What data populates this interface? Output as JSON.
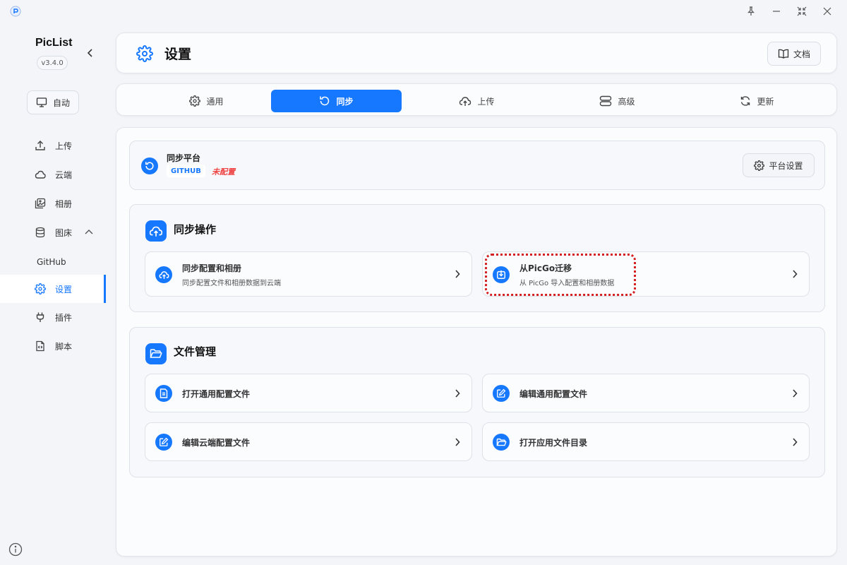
{
  "sidebar": {
    "brand": "PicList",
    "version": "v3.4.0",
    "theme_label": "自动",
    "nav": [
      {
        "label": "上传",
        "icon": "upload-icon"
      },
      {
        "label": "云端",
        "icon": "cloud-icon"
      },
      {
        "label": "相册",
        "icon": "gallery-icon"
      },
      {
        "label": "图床",
        "icon": "database-icon"
      },
      {
        "label": "设置",
        "icon": "gear-icon"
      },
      {
        "label": "插件",
        "icon": "plug-icon"
      },
      {
        "label": "脚本",
        "icon": "script-icon"
      }
    ],
    "sub_item": "GitHub",
    "active": "设置"
  },
  "header": {
    "title": "设置",
    "doc_label": "文档"
  },
  "tabs": [
    {
      "label": "通用",
      "icon": "gear-icon"
    },
    {
      "label": "同步",
      "icon": "sync-icon"
    },
    {
      "label": "上传",
      "icon": "cloud-upload-icon"
    },
    {
      "label": "高级",
      "icon": "advanced-icon"
    },
    {
      "label": "更新",
      "icon": "refresh-icon"
    }
  ],
  "active_tab": "同步",
  "platform": {
    "title": "同步平台",
    "badge": "GITHUB",
    "status": "未配置",
    "settings_label": "平台设置"
  },
  "sync_section": {
    "title": "同步操作",
    "actions": [
      {
        "title": "同步配置和相册",
        "desc": "同步配置文件和相册数据到云端",
        "icon": "cloud-upload-icon"
      },
      {
        "title": "从PicGo迁移",
        "desc": "从 PicGo 导入配置和相册数据",
        "icon": "import-icon"
      }
    ]
  },
  "file_section": {
    "title": "文件管理",
    "actions": [
      {
        "title": "打开通用配置文件",
        "icon": "file-icon"
      },
      {
        "title": "编辑通用配置文件",
        "icon": "edit-icon"
      },
      {
        "title": "编辑云端配置文件",
        "icon": "edit-icon"
      },
      {
        "title": "打开应用文件目录",
        "icon": "folder-icon"
      }
    ]
  },
  "colors": {
    "accent": "#1677ff",
    "warning": "#ef4444",
    "highlight": "#d42020"
  }
}
